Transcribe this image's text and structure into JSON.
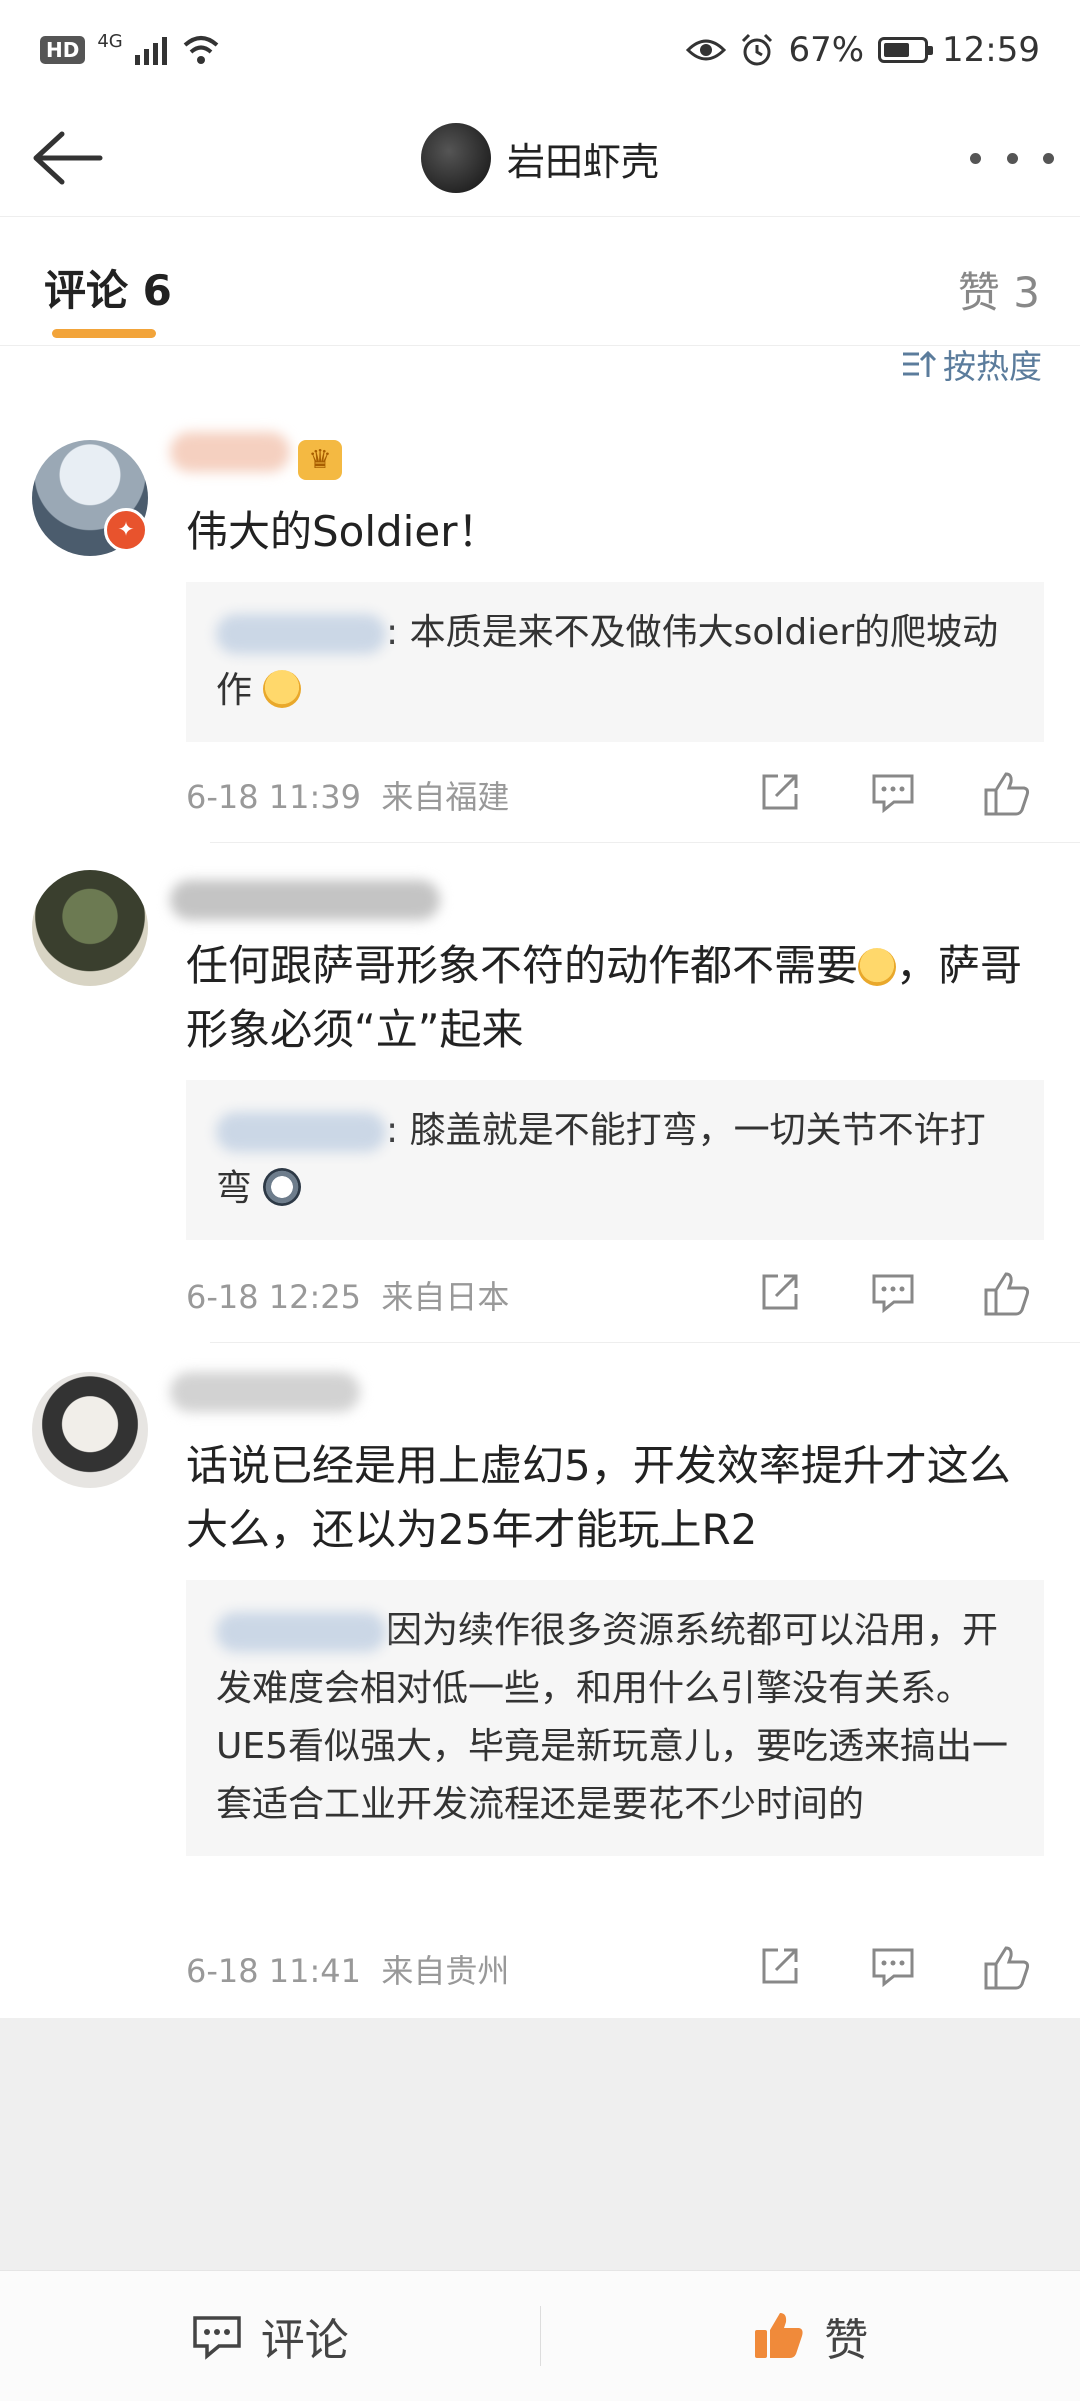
{
  "status_bar": {
    "hd": "HD",
    "signal_label": "4G",
    "battery": "67%",
    "battery_level": 0.67,
    "time": "12:59"
  },
  "nav": {
    "title": "岩田虾壳"
  },
  "tabs": {
    "comments": "评论 6",
    "likes": "赞 3"
  },
  "sort_label": "按热度",
  "comments": [
    {
      "text": "伟大的Soldier！",
      "reply": ": 本质是来不及做伟大soldier的爬坡动作",
      "time": "6-18 11:39",
      "location": "来自福建"
    },
    {
      "text": "任何跟萨哥形象不符的动作都不需要",
      "text_tail": "，萨哥形象必须“立”起来",
      "reply": ": 膝盖就是不能打弯，一切关节不许打弯",
      "time": "6-18 12:25",
      "location": "来自日本"
    },
    {
      "text": "话说已经是用上虚幻5，开发效率提升才这么大么，还以为25年才能玩上R2",
      "reply": "因为续作很多资源系统都可以沿用，开发难度会相对低一些，和用什么引擎没有关系。UE5看似强大，毕竟是新玩意儿，要吃透来搞出一套适合工业开发流程还是要花不少时间的",
      "time": "6-18 11:41",
      "location": "来自贵州"
    }
  ],
  "bottom_bar": {
    "comment": "评论",
    "like": "赞"
  },
  "colors": {
    "accent": "#f2a43a",
    "link": "#5b7c9c",
    "like_orange": "#f08a3a"
  }
}
